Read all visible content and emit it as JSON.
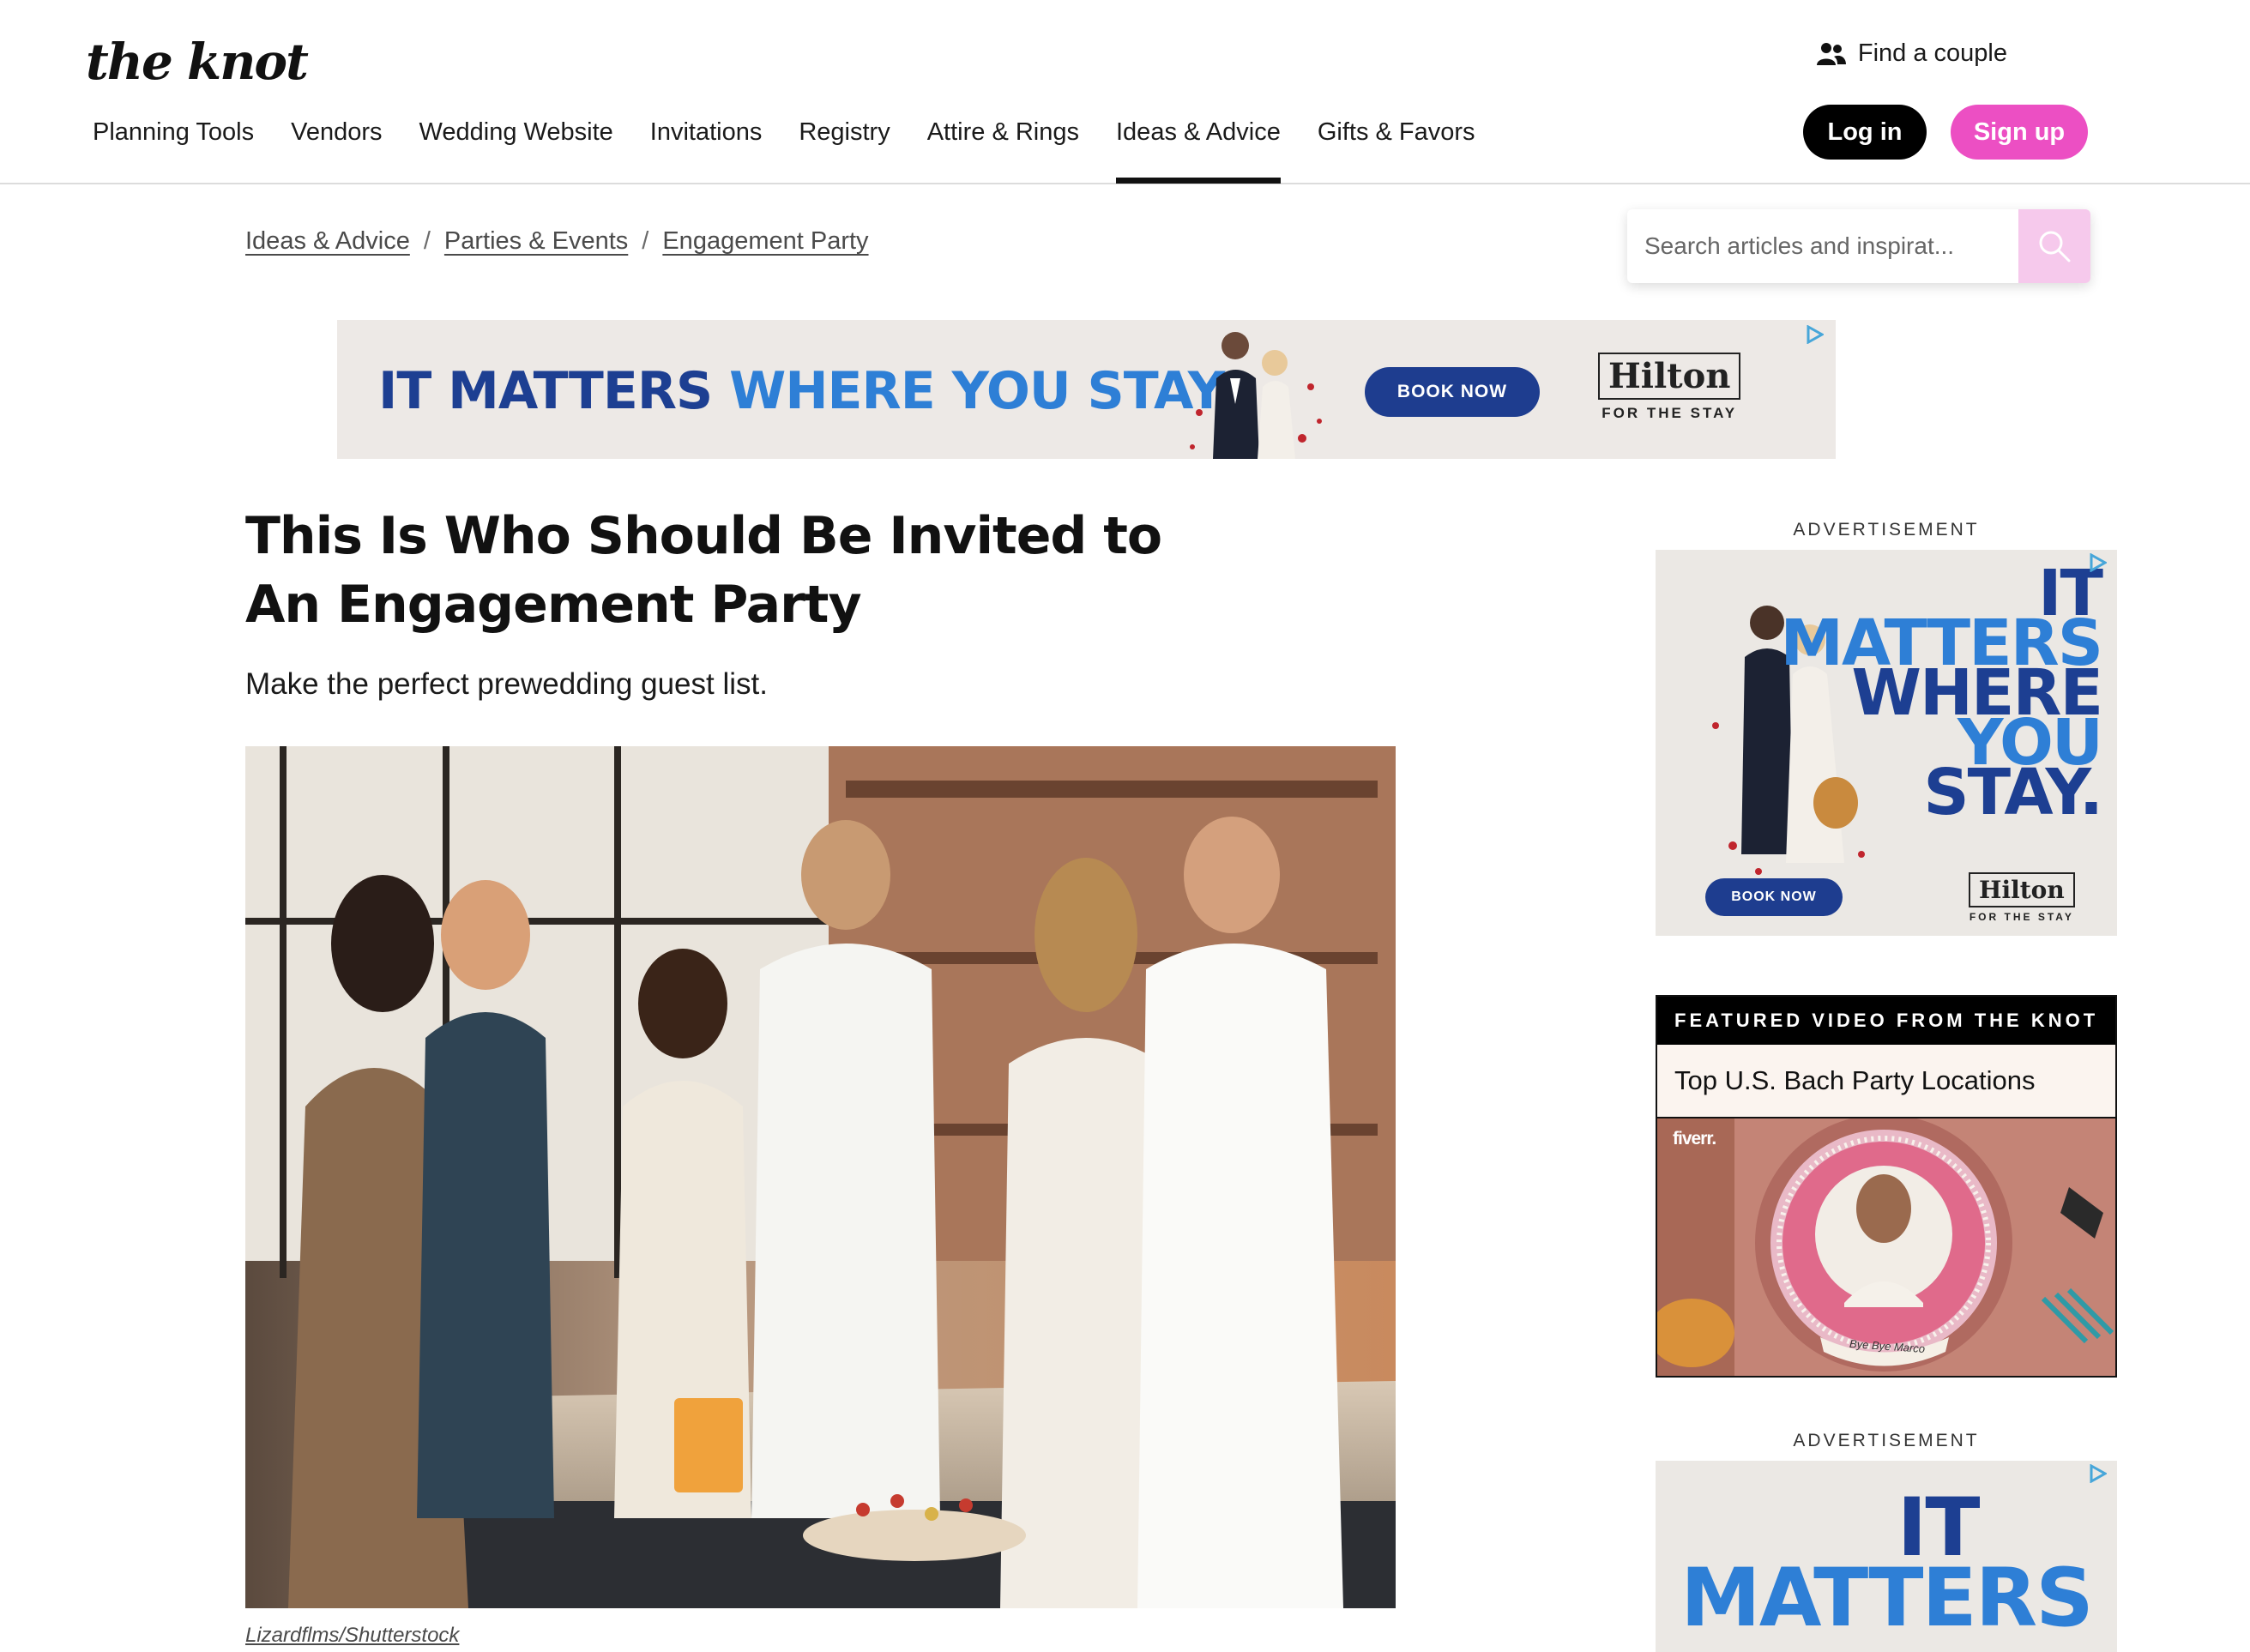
{
  "header": {
    "logo": "the knot",
    "find_couple": "Find a couple",
    "nav": [
      "Planning Tools",
      "Vendors",
      "Wedding Website",
      "Invitations",
      "Registry",
      "Attire & Rings",
      "Ideas & Advice",
      "Gifts & Favors"
    ],
    "active_nav": "Ideas & Advice",
    "login_label": "Log in",
    "signup_label": "Sign up"
  },
  "breadcrumb": [
    "Ideas & Advice",
    "Parties & Events",
    "Engagement Party"
  ],
  "search": {
    "placeholder": "Search articles and inspirat..."
  },
  "banner_ad": {
    "headline_dark": "IT MATTERS",
    "headline_light": "WHERE YOU STAY.",
    "cta": "BOOK NOW",
    "brand": "Hilton",
    "brand_tagline": "FOR THE STAY"
  },
  "article": {
    "title": "This Is Who Should Be Invited to An Engagement Party",
    "subtitle": "Make the perfect prewedding guest list.",
    "photo_credit": "Lizardflms/Shutterstock"
  },
  "sidebar": {
    "ad_label": "ADVERTISEMENT",
    "ad1": {
      "words": [
        "IT",
        "MATTERS",
        "WHERE",
        "YOU",
        "STAY."
      ],
      "cta": "BOOK NOW",
      "brand": "Hilton",
      "brand_tagline": "FOR THE STAY"
    },
    "featured_video": {
      "header": "FEATURED VIDEO FROM THE KNOT",
      "title": "Top U.S. Bach Party Locations",
      "thumb_brand": "fiverr.",
      "thumb_caption": "Bye Bye Marco"
    },
    "ad2_label": "ADVERTISEMENT",
    "ad2": {
      "words": [
        "IT",
        "MATTERS"
      ]
    }
  },
  "colors": {
    "brand_pink": "#ec4fc3",
    "ad_navy": "#1d3f92",
    "ad_blue": "#2e7fd6"
  }
}
